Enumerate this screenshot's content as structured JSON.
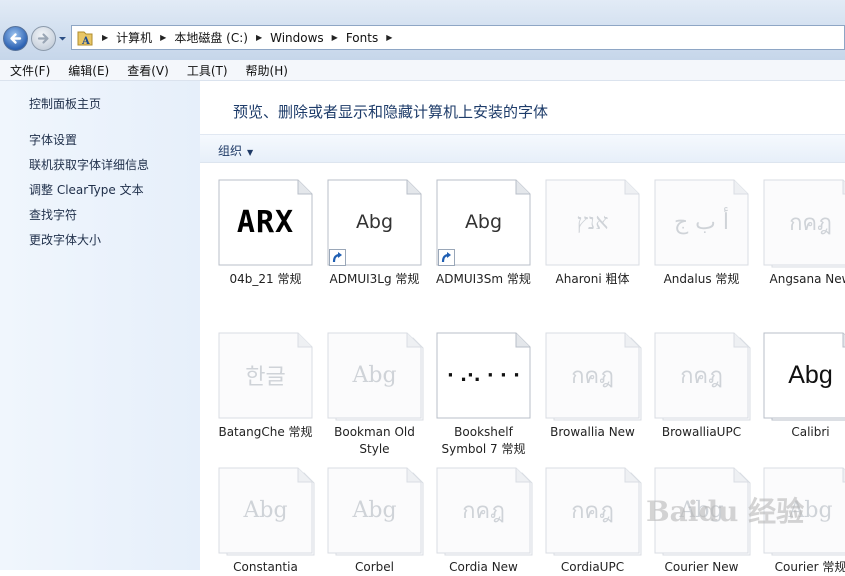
{
  "window": {
    "breadcrumbs": [
      "计算机",
      "本地磁盘 (C:)",
      "Windows",
      "Fonts"
    ]
  },
  "menu": [
    "文件(F)",
    "编辑(E)",
    "查看(V)",
    "工具(T)",
    "帮助(H)"
  ],
  "sidebar": {
    "home": "控制面板主页",
    "links": [
      "字体设置",
      "联机获取字体详细信息",
      "调整 ClearType 文本",
      "查找字符",
      "更改字体大小"
    ]
  },
  "main": {
    "heading": "预览、删除或者显示和隐藏计算机上安装的字体",
    "organize": "组织"
  },
  "fonts": [
    {
      "name": "04b_21 常规",
      "preview": "ARX",
      "style": "bold",
      "shortcut": false,
      "stacked": false
    },
    {
      "name": "ADMUI3Lg 常规",
      "preview": "Abg",
      "style": "normal",
      "shortcut": true,
      "stacked": false
    },
    {
      "name": "ADMUI3Sm 常规",
      "preview": "Abg",
      "style": "normal",
      "shortcut": true,
      "stacked": false
    },
    {
      "name": "Aharoni 粗体",
      "preview": "אנץ",
      "style": "faded",
      "shortcut": false,
      "stacked": false
    },
    {
      "name": "Andalus 常规",
      "preview": "أ ب ج",
      "style": "faded",
      "shortcut": false,
      "stacked": false
    },
    {
      "name": "Angsana New",
      "preview": "กคฎ",
      "style": "faded",
      "shortcut": false,
      "stacked": true
    },
    {
      "name": "BatangChe 常规",
      "preview": "한글",
      "style": "faded",
      "shortcut": false,
      "stacked": false
    },
    {
      "name": "Bookman Old Style",
      "preview": "Abg",
      "style": "faded",
      "shortcut": false,
      "stacked": true
    },
    {
      "name": "Bookshelf Symbol 7 常规",
      "preview": "· .·. ·  ·  ·",
      "style": "symbol",
      "shortcut": false,
      "stacked": false
    },
    {
      "name": "Browallia New",
      "preview": "กคฎ",
      "style": "faded",
      "shortcut": false,
      "stacked": true
    },
    {
      "name": "BrowalliaUPC",
      "preview": "กคฎ",
      "style": "faded",
      "shortcut": false,
      "stacked": true
    },
    {
      "name": "Calibri",
      "preview": "Abg",
      "style": "large",
      "shortcut": false,
      "stacked": true
    },
    {
      "name": "Constantia",
      "preview": "Abg",
      "style": "faded",
      "shortcut": false,
      "stacked": true
    },
    {
      "name": "Corbel",
      "preview": "Abg",
      "style": "faded",
      "shortcut": false,
      "stacked": true
    },
    {
      "name": "Cordia New",
      "preview": "กคฎ",
      "style": "faded",
      "shortcut": false,
      "stacked": true
    },
    {
      "name": "CordiaUPC",
      "preview": "กคฎ",
      "style": "faded",
      "shortcut": false,
      "stacked": true
    },
    {
      "name": "Courier New",
      "preview": "Abg",
      "style": "faded",
      "shortcut": false,
      "stacked": true
    },
    {
      "name": "Courier 常规",
      "preview": "Abg",
      "style": "faded",
      "shortcut": false,
      "stacked": true
    }
  ],
  "watermark": "Baidu 经验"
}
